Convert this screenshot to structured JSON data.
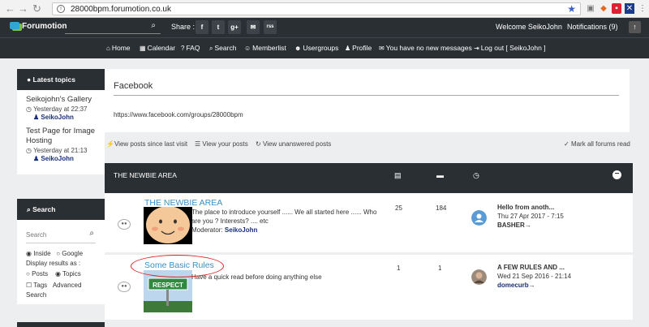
{
  "browser": {
    "url": "28000bpm.forumotion.co.uk"
  },
  "topbar": {
    "logo": "Forumotion",
    "share_label": "Share :",
    "share_buttons": [
      "f",
      "t",
      "g+",
      "✉",
      "rss"
    ],
    "welcome": "Welcome SeikoJohn",
    "notifications": "Notifications  (9)"
  },
  "navbar": [
    "Home",
    "Calendar",
    "FAQ",
    "Search",
    "Memberlist",
    "Usergroups",
    "Profile",
    "You have no new messages",
    "Log out [ SeikoJohn ]"
  ],
  "latest_topics": {
    "title": "Latest topics",
    "items": [
      {
        "title": "Seikojohn's Gallery",
        "time": "Yesterday at 22:37",
        "user": "SeikoJohn"
      },
      {
        "title": "Test Page for Image Hosting",
        "time": "Yesterday at 21:13",
        "user": "SeikoJohn"
      }
    ]
  },
  "search_box": {
    "title": "Search",
    "placeholder": "Search",
    "radio_inside": "Inside",
    "radio_google": "Google",
    "display_label": "Display results as :",
    "radio_posts": "Posts",
    "radio_topics": "Topics",
    "tags_label": "Tags",
    "advanced_label": "Advanced",
    "search_link": "Search"
  },
  "facebook": {
    "title": "Facebook",
    "url": "https://www.facebook.com/groups/28000bpm"
  },
  "quick_links": {
    "since_last": "View posts since last visit",
    "your_posts": "View your posts",
    "unanswered": "View unanswered posts",
    "mark_read": "Mark all forums read"
  },
  "category": {
    "title": "THE NEWBIE AREA"
  },
  "forums": [
    {
      "name": "THE NEWBIE AREA",
      "description": "The place to introduce yourself ...... We all started here ...... Who are you ? Interests? .... etc",
      "moderator_label": "Moderator:",
      "moderator": "SeikoJohn",
      "topics": "25",
      "posts": "184",
      "last_title": "Hello from anoth...",
      "last_date": "Thu 27 Apr 2017 - 7:15",
      "last_user": "BASHER"
    },
    {
      "name": "Some Basic Rules",
      "description": "Have a quick read before doing anything else",
      "topics": "1",
      "posts": "1",
      "last_title": "A FEW RULES AND ...",
      "last_date": "Wed 21 Sep 2016 - 21:14",
      "last_user": "domecurb"
    }
  ],
  "images": {
    "respect_sign": "RESPECT"
  },
  "colors": {
    "dark": "#2a2f33",
    "link": "#3b8fc4",
    "annotation": "#dd2222"
  }
}
